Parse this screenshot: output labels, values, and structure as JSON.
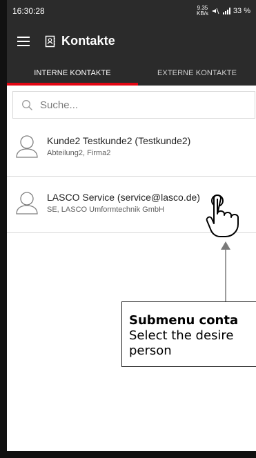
{
  "status_bar": {
    "time": "16:30:28",
    "network_speed_top": "9.35",
    "network_speed_bottom": "KB/s",
    "battery": "33 %"
  },
  "app_bar": {
    "title": "Kontakte"
  },
  "tabs": [
    {
      "label": "INTERNE KONTAKTE"
    },
    {
      "label": "EXTERNE KONTAKTE"
    }
  ],
  "search": {
    "placeholder": "Suche..."
  },
  "contacts": [
    {
      "name": "Kunde2 Testkunde2 (Testkunde2)",
      "meta": "Abteilung2, Firma2"
    },
    {
      "name": "LASCO Service (service@lasco.de)",
      "meta": "SE, LASCO Umformtechnik GmbH"
    }
  ],
  "callout": {
    "title": "Submenu conta",
    "line1": "Select the desire",
    "line2": "person"
  },
  "colors": {
    "app_bar": "#2b2b2b",
    "accent_red": "#e30613",
    "divider": "#d8d8d8",
    "text": "#1f1f1f"
  }
}
